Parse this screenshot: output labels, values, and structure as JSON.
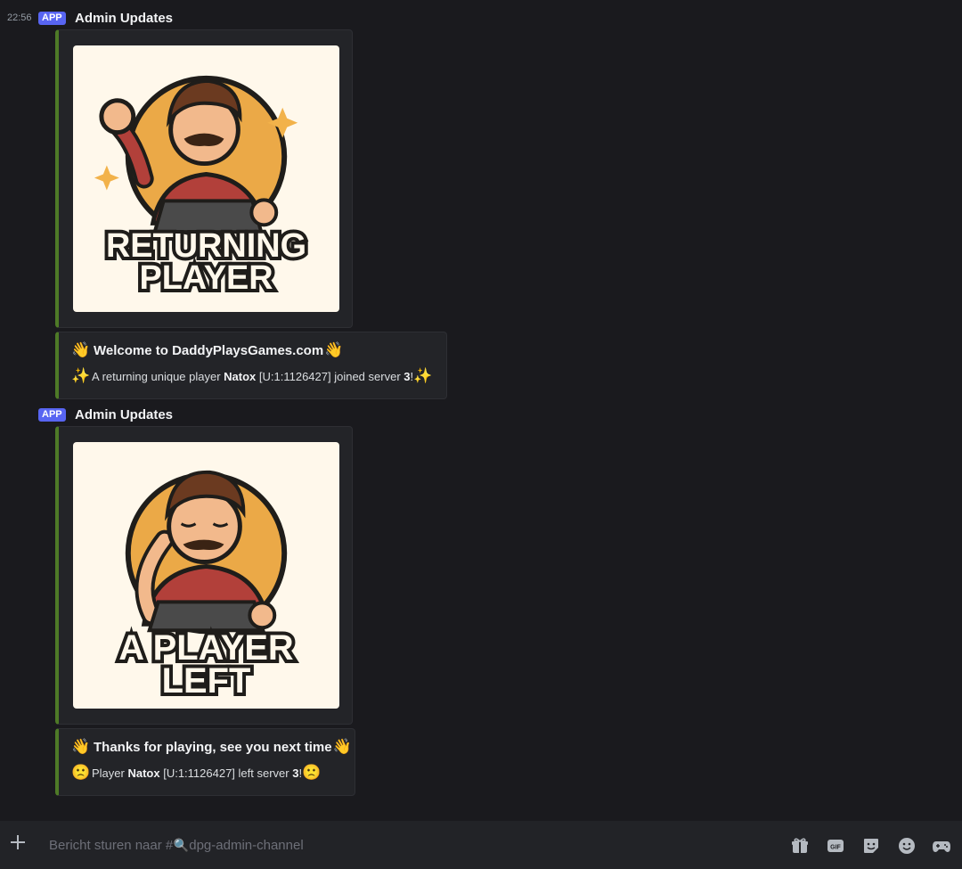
{
  "messages": [
    {
      "time": "22:56",
      "badge": "APP",
      "author": "Admin Updates",
      "image": {
        "line1": "RETURNING",
        "line2": "PLAYER",
        "mood": "cheering"
      },
      "embed": {
        "title": "Welcome to DaddyPlaysGames.com",
        "title_emoji": "👋",
        "desc_emoji": "✨",
        "desc_parts": [
          "A returning unique player ",
          "Natox",
          " [U:1:1126427] joined server ",
          "3",
          "!"
        ]
      }
    },
    {
      "badge": "APP",
      "author": "Admin Updates",
      "image": {
        "line1": "A PLAYER",
        "line2": "LEFT",
        "mood": "sad"
      },
      "embed": {
        "title": "Thanks for playing, see you next time",
        "title_emoji": "👋",
        "desc_emoji": "🙁",
        "desc_parts": [
          "Player ",
          "Natox",
          " [U:1:1126427] left server ",
          "3",
          "!"
        ]
      }
    }
  ],
  "composer": {
    "placeholder": "Bericht sturen naar #",
    "channel_emoji": "🔍",
    "channel": "dpg-admin-channel",
    "icons": [
      "gift-icon",
      "gif-icon",
      "sticker-icon",
      "emoji-icon",
      "gamepad-icon"
    ],
    "gif_label": "GIF"
  },
  "colors": {
    "accent": "#5865f2",
    "embed_border": "#4e7a27",
    "background": "#1a1a1e"
  }
}
